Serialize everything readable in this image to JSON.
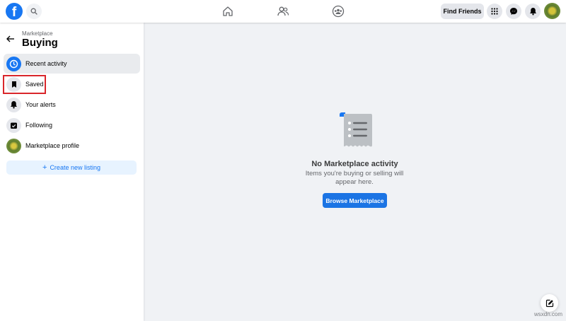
{
  "topbar": {
    "logo_letter": "f",
    "find_friends_label": "Find Friends",
    "icons": {
      "logo": "facebook-logo-icon",
      "search": "search-icon",
      "home": "home-icon",
      "friends": "friends-icon",
      "groups": "groups-icon",
      "menu": "grid-menu-icon",
      "messenger": "messenger-icon",
      "notifications": "bell-icon",
      "profile": "avatar"
    }
  },
  "sidebar": {
    "breadcrumb": "Marketplace",
    "title": "Buying",
    "items": [
      {
        "label": "Recent activity",
        "icon": "clock-icon",
        "active": true
      },
      {
        "label": "Saved",
        "icon": "bookmark-icon",
        "active": false
      },
      {
        "label": "Your alerts",
        "icon": "bell-icon",
        "active": false
      },
      {
        "label": "Following",
        "icon": "calendar-check-icon",
        "active": false
      },
      {
        "label": "Marketplace profile",
        "icon": "profile-avatar",
        "active": false
      }
    ],
    "create_button": {
      "plus": "+",
      "label": "Create new listing"
    }
  },
  "main": {
    "empty_title": "No Marketplace activity",
    "empty_subtitle": "Items you're buying or selling will appear here.",
    "browse_button": "Browse Marketplace"
  },
  "colors": {
    "brand": "#1877f2",
    "page_background": "#f0f2f5",
    "highlight_box": "#d9262b"
  },
  "watermark": "wsxdn.com"
}
